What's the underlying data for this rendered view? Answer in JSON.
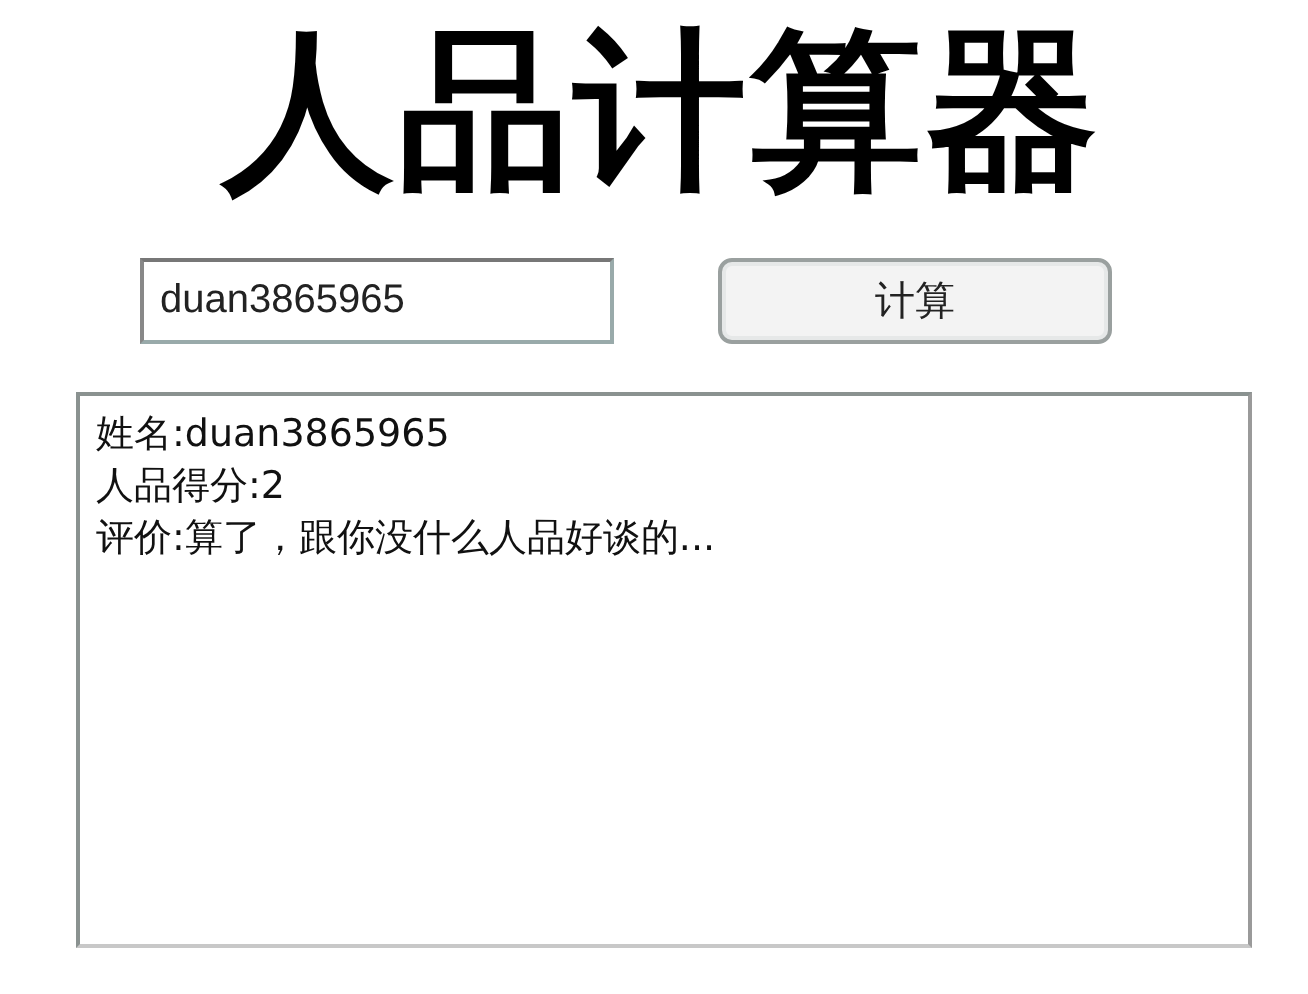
{
  "title": "人品计算器",
  "name_field": {
    "value": "duan3865965"
  },
  "calculate_button": "计算",
  "result_lines": [
    "姓名:duan3865965",
    "人品得分:2",
    "评价:算了，跟你没什么人品好谈的..."
  ]
}
